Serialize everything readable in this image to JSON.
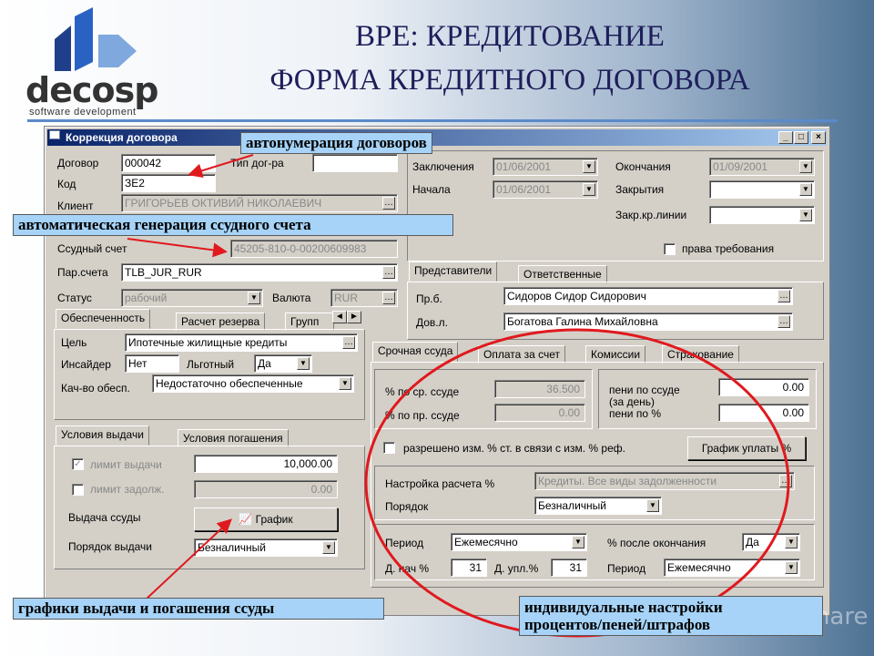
{
  "slide": {
    "title_line1": "ВРЕ: КРЕДИТОВАНИЕ",
    "title_line2": "ФОРМА КРЕДИТНОГО ДОГОВОРА",
    "logo_text": "decosp",
    "logo_subtitle": "software development",
    "watermark": "SlideShare"
  },
  "window": {
    "title": "Коррекция договора",
    "minimize": "_",
    "maximize": "□",
    "close": "×"
  },
  "contract": {
    "dogovor_label": "Договор",
    "dogovor_value": "000042",
    "kod_label": "Код",
    "kod_value": "ЗЕ2",
    "tip_label": "Тип дог-ра",
    "tip_value": "",
    "klient_label": "Клиент",
    "klient_value": "ГРИГОРЬЕВ ОКТИВИЙ НИКОЛАЕВИЧ",
    "ssudny_label": "Ссудный счет",
    "ssudny_value": "45205-810-0-00200609983",
    "par_label": "Пар.счета",
    "par_value": "TLB_JUR_RUR",
    "status_label": "Статус",
    "status_value": "рабочий",
    "valuta_label": "Валюта",
    "valuta_value": "RUR"
  },
  "dates": {
    "zakl_label": "Заключения",
    "zakl_value": "01/06/2001",
    "nach_label": "Начала",
    "nach_value": "01/06/2001",
    "okonch_label": "Окончания",
    "okonch_value": "01/09/2001",
    "zakr_label": "Закрытия",
    "zakr_value": "",
    "zakrkr_label": "Закр.кр.линии",
    "zakrkr_value": "",
    "prava_label": "права требования"
  },
  "reps": {
    "tabs": [
      "Представители",
      "Ответственные"
    ],
    "pb_label": "Пр.б.",
    "pb_value": "Сидоров Сидор Сидорович",
    "dovl_label": "Дов.л.",
    "dovl_value": "Богатова Галина Михайловна"
  },
  "collateral": {
    "tabs": [
      "Обеспеченность",
      "Расчет резерва",
      "Групп"
    ],
    "cel_label": "Цель",
    "cel_value": "Ипотечные жилищные кредиты",
    "insider_label": "Инсайдер",
    "insider_value": "Нет",
    "lgot_label": "Льготный",
    "lgot_value": "Да",
    "kach_label": "Кач-во обесп.",
    "kach_value": "Недостаточно обеспеченные"
  },
  "issue": {
    "tabs": [
      "Условия выдачи",
      "Условия погашения"
    ],
    "limit_label": "лимит выдачи",
    "limit_value": "10,000.00",
    "zadolzh_label": "лимит задолж.",
    "zadolzh_value": "0.00",
    "vydacha_label": "Выдача ссуды",
    "grafik_button": "График",
    "poryadok_label": "Порядок выдачи",
    "poryadok_value": "Безналичный"
  },
  "loan": {
    "tabs": [
      "Срочная ссуда",
      "Оплата за счет",
      "Комиссии",
      "Страхование"
    ],
    "pct_sr_label": "% по ср. ссуде",
    "pct_sr_value": "36.500",
    "pct_pr_label": "% по пр. ссуде",
    "pct_pr_value": "0.00",
    "peni_label": "пени по ссуде",
    "peni_value": "0.00",
    "za_den_label": "(за день)",
    "peni_pct_label": "пени по %",
    "peni_pct_value": "0.00",
    "allow_label": "разрешено изм. % ст. в связи с изм. % реф.",
    "grafik_uplaty": "График уплаты %",
    "nastr_label": "Настройка расчета %",
    "nastr_value": "Кредиты. Все виды задолженности",
    "poryadok_label": "Порядок",
    "poryadok_value": "Безналичный",
    "period_label": "Период",
    "period_value": "Ежемесячно",
    "posle_label": "% после окончания",
    "posle_value": "Да",
    "dnach_label": "Д. нач %",
    "dnach_value": "31",
    "dupl_label": "Д. упл.%",
    "dupl_value": "31",
    "period2_label": "Период",
    "period2_value": "Ежемесячно"
  },
  "callouts": {
    "autonum": "автонумерация договоров",
    "autogen": "автоматическая генерация ссудного счета",
    "graphs": "графики выдачи и погашения ссуды",
    "individual_line1": "индивидуальные настройки",
    "individual_line2": "процентов/пеней/штрафов"
  },
  "colors": {
    "titlebar": "#0a246a",
    "callout_bg": "#a6d3f7",
    "annotation_red": "#e0191e"
  }
}
